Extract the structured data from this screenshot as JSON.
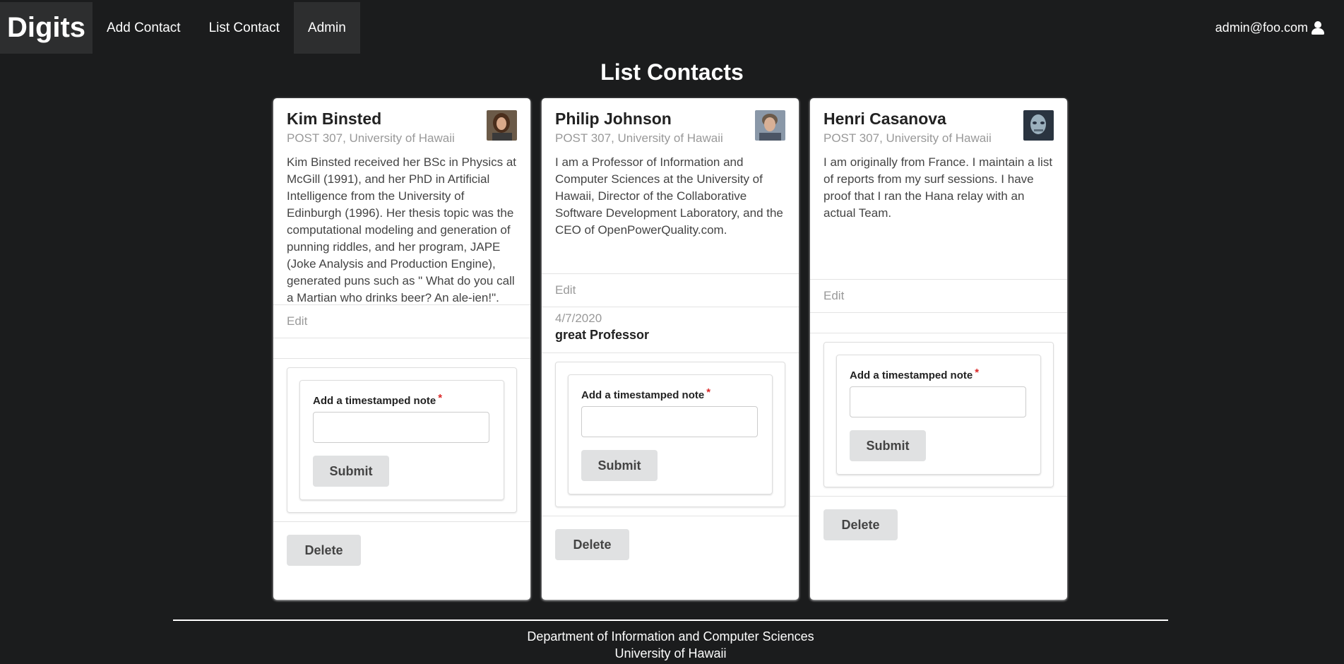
{
  "menu": {
    "brand": "Digits",
    "items": [
      "Add Contact",
      "List Contact",
      "Admin"
    ],
    "user": "admin@foo.com"
  },
  "page_title": "List Contacts",
  "contacts": [
    {
      "name": "Kim Binsted",
      "address": "POST 307, University of Hawaii",
      "description": "Kim Binsted received her BSc in Physics at McGill (1991), and her PhD in Artificial Intelligence from the University of Edinburgh (1996). Her thesis topic was the computational modeling and generation of punning riddles, and her program, JAPE (Joke Analysis and Production Engine), generated puns such as \" What do you call a Martian who drinks beer? An ale-ien!\".",
      "edit": "Edit",
      "notes": [],
      "note_label": "Add a timestamped note",
      "submit": "Submit",
      "delete": "Delete"
    },
    {
      "name": "Philip Johnson",
      "address": "POST 307, University of Hawaii",
      "description": "I am a Professor of Information and Computer Sciences at the University of Hawaii, Director of the Collaborative Software Development Laboratory, and the CEO of OpenPowerQuality.com.",
      "edit": "Edit",
      "notes": [
        {
          "date": "4/7/2020",
          "text": "great Professor"
        }
      ],
      "note_label": "Add a timestamped note",
      "submit": "Submit",
      "delete": "Delete"
    },
    {
      "name": "Henri Casanova",
      "address": "POST 307, University of Hawaii",
      "description": "I am originally from France. I maintain a list of reports from my surf sessions. I have proof that I ran the Hana relay with an actual Team.",
      "edit": "Edit",
      "notes": [],
      "note_label": "Add a timestamped note",
      "submit": "Submit",
      "delete": "Delete"
    }
  ],
  "footer": {
    "line1": "Department of Information and Computer Sciences",
    "line2": "University of Hawaii"
  }
}
